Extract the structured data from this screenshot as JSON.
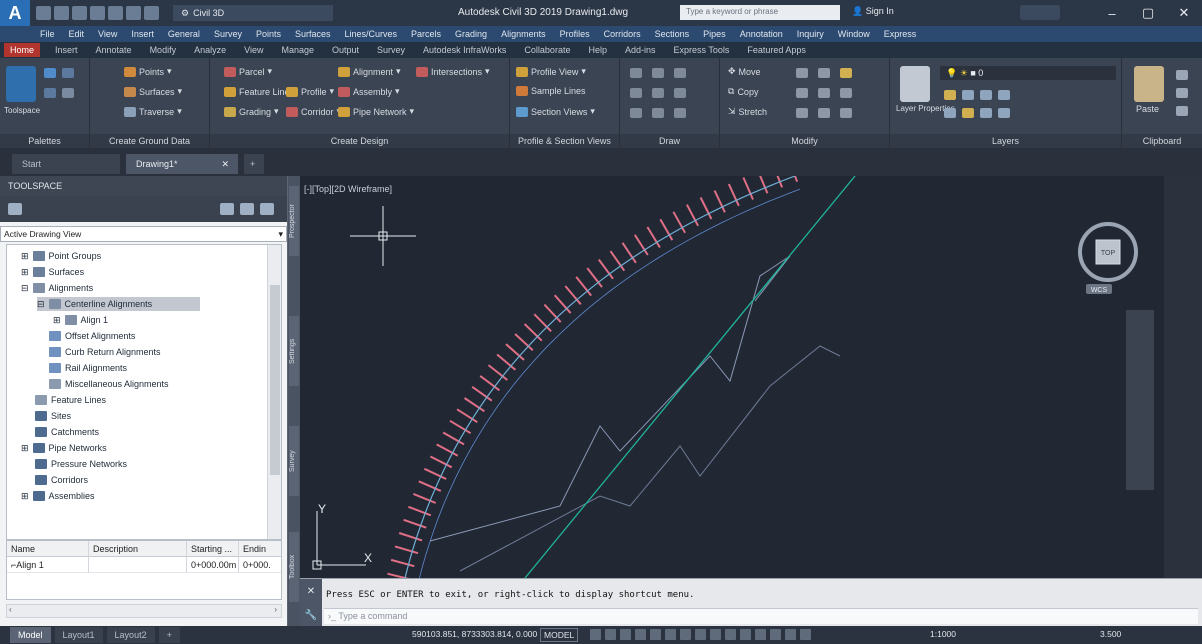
{
  "titlebar": {
    "workspace": "Civil 3D",
    "title": "Autodesk Civil 3D 2019   Drawing1.dwg",
    "search_placeholder": "Type a keyword or phrase",
    "signin": "Sign In"
  },
  "menubar": [
    "File",
    "Edit",
    "View",
    "Insert",
    "General",
    "Survey",
    "Points",
    "Surfaces",
    "Lines/Curves",
    "Parcels",
    "Grading",
    "Alignments",
    "Profiles",
    "Corridors",
    "Sections",
    "Pipes",
    "Annotation",
    "Inquiry",
    "Window",
    "Express"
  ],
  "ribbon_tabs": [
    "Home",
    "Insert",
    "Annotate",
    "Modify",
    "Analyze",
    "View",
    "Manage",
    "Output",
    "Survey",
    "Autodesk InfraWorks",
    "Collaborate",
    "Help",
    "Add-ins",
    "Express Tools",
    "Featured Apps"
  ],
  "ribbon": {
    "palettes": {
      "title": "Palettes",
      "toolspace": "Toolspace"
    },
    "ground": {
      "title": "Create Ground Data",
      "points": "Points",
      "surfaces": "Surfaces",
      "traverse": "Traverse"
    },
    "design": {
      "title": "Create Design",
      "parcel": "Parcel",
      "feature_line": "Feature Line",
      "grading": "Grading",
      "profile": "Profile",
      "corridor": "Corridor",
      "alignment": "Alignment",
      "assembly": "Assembly",
      "intersections": "Intersections",
      "pipe_network": "Pipe Network"
    },
    "profile_section": {
      "title": "Profile & Section Views",
      "profile_view": "Profile View",
      "sample_lines": "Sample Lines",
      "section_views": "Section Views"
    },
    "draw": {
      "title": "Draw"
    },
    "modify": {
      "title": "Modify",
      "move": "Move",
      "copy": "Copy",
      "stretch": "Stretch"
    },
    "layers": {
      "title": "Layers",
      "layer_properties": "Layer Properties",
      "layer_value": "0"
    },
    "clipboard": {
      "title": "Clipboard",
      "paste": "Paste"
    }
  },
  "file_tabs": {
    "start": "Start",
    "drawing": "Drawing1*",
    "new": "+"
  },
  "toolspace": {
    "header": "TOOLSPACE",
    "view": "Active Drawing View",
    "tree": [
      {
        "label": "Point Groups",
        "indent": 1
      },
      {
        "label": "Surfaces",
        "indent": 1
      },
      {
        "label": "Alignments",
        "indent": 1
      },
      {
        "label": "Centerline Alignments",
        "indent": 2,
        "selected": true
      },
      {
        "label": "Align 1",
        "indent": 3
      },
      {
        "label": "Offset Alignments",
        "indent": 2
      },
      {
        "label": "Curb Return Alignments",
        "indent": 2
      },
      {
        "label": "Rail Alignments",
        "indent": 2
      },
      {
        "label": "Miscellaneous Alignments",
        "indent": 2
      },
      {
        "label": "Feature Lines",
        "indent": 1
      },
      {
        "label": "Sites",
        "indent": 1
      },
      {
        "label": "Catchments",
        "indent": 1
      },
      {
        "label": "Pipe Networks",
        "indent": 1
      },
      {
        "label": "Pressure Networks",
        "indent": 1
      },
      {
        "label": "Corridors",
        "indent": 1
      },
      {
        "label": "Assemblies",
        "indent": 1
      }
    ],
    "list": {
      "columns": [
        "Name",
        "Description",
        "Starting ...",
        "Endin"
      ],
      "rows": [
        [
          "Align 1",
          "",
          "0+000.00m",
          "0+000."
        ]
      ]
    }
  },
  "palette_tabs": [
    "Prospector",
    "Settings",
    "Survey",
    "Toolbox"
  ],
  "viewport": {
    "label": "[-][Top][2D Wireframe]",
    "axis_y": "Y",
    "axis_x": "X",
    "viewcube": "TOP",
    "wcs": "WCS"
  },
  "command": {
    "message": "Press ESC or ENTER to exit, or right-click to display shortcut menu.",
    "placeholder": "Type a command"
  },
  "statusbar": {
    "layouts": [
      "Model",
      "Layout1",
      "Layout2"
    ],
    "coords": "590103.851, 8733303.814, 0.000",
    "model": "MODEL",
    "scale": "1:1000",
    "scale2": "3.500"
  },
  "colors": {
    "accent": "#b2342e",
    "alignment": "#6fb0d6",
    "feature_line": "#1fb49a",
    "station_ticks": "#e06f86"
  }
}
